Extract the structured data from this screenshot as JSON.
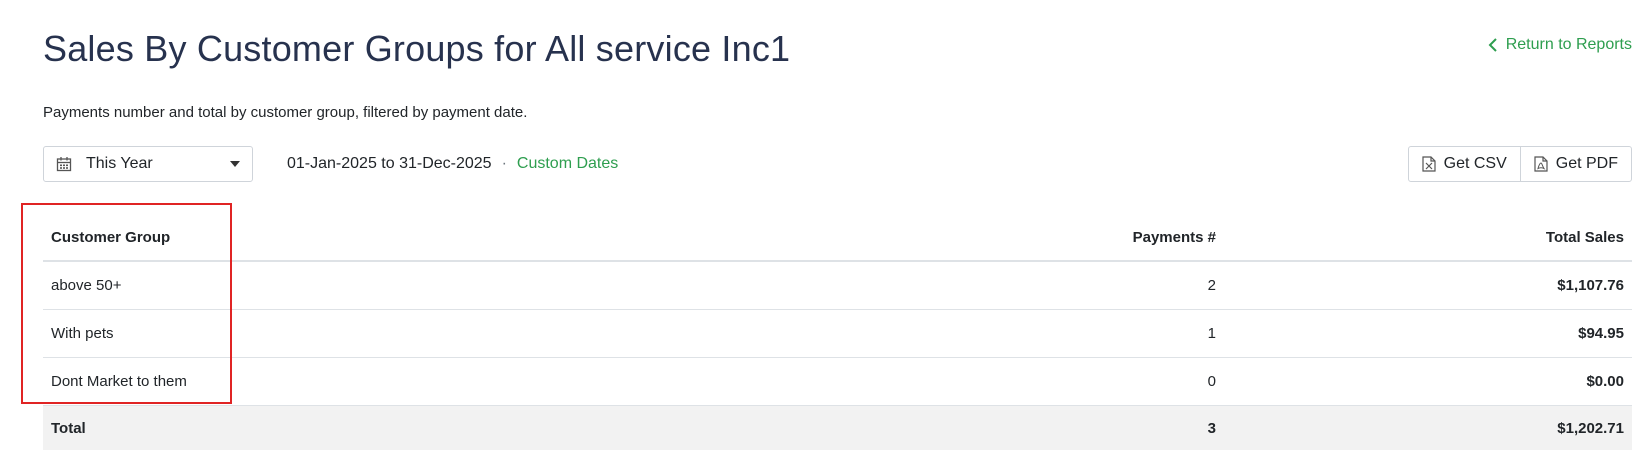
{
  "header": {
    "title": "Sales By Customer Groups for All service Inc1",
    "return_link": "Return to Reports",
    "description": "Payments number and total by customer group, filtered by payment date."
  },
  "filters": {
    "period_selected": "This Year",
    "date_range": "01-Jan-2025 to 31-Dec-2025",
    "separator": "·",
    "custom_dates_label": "Custom Dates"
  },
  "exports": {
    "csv_label": "Get CSV",
    "pdf_label": "Get PDF"
  },
  "table": {
    "columns": [
      "Customer Group",
      "Payments #",
      "Total Sales"
    ],
    "rows": [
      {
        "group": "above 50+",
        "payments": "2",
        "total": "$1,107.76"
      },
      {
        "group": "With pets",
        "payments": "1",
        "total": "$94.95"
      },
      {
        "group": "Dont Market to them",
        "payments": "0",
        "total": "$0.00"
      }
    ],
    "total": {
      "label": "Total",
      "payments": "3",
      "total": "$1,202.71"
    }
  },
  "colors": {
    "title": "#27324e",
    "link_green": "#2e9e4f",
    "highlight_red": "#e02424",
    "total_row_bg": "#f2f2f2"
  },
  "icons": {
    "return": "chevron-left-icon",
    "date_select": "calendar-icon",
    "dropdown": "caret-down-icon",
    "csv": "file-excel-icon",
    "pdf": "file-pdf-icon"
  }
}
